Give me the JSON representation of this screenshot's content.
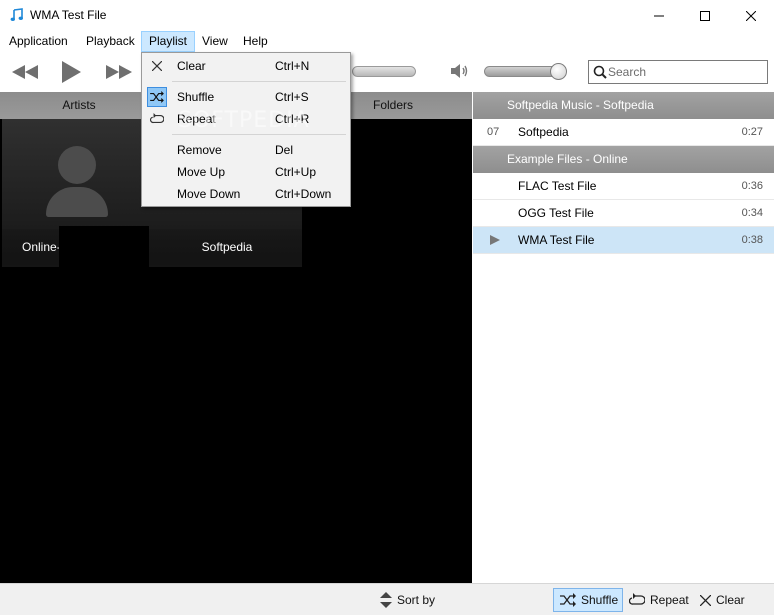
{
  "window": {
    "title": "WMA Test File"
  },
  "menu": [
    "Application",
    "Playback",
    "Playlist",
    "View",
    "Help"
  ],
  "search": {
    "placeholder": "Search",
    "value": ""
  },
  "volume": {
    "level": 0.88
  },
  "library": {
    "tabs": [
      "Artists",
      "",
      "Folders"
    ],
    "tiles": [
      "Online-",
      "Softpedia"
    ]
  },
  "dropdown": {
    "items": [
      {
        "label": "Clear",
        "shortcut": "Ctrl+N",
        "icon": "close-icon"
      },
      {
        "label": "Shuffle",
        "shortcut": "Ctrl+S",
        "icon": "shuffle-icon",
        "checked": true
      },
      {
        "label": "Repeat",
        "shortcut": "Ctrl+R",
        "icon": "repeat-icon"
      },
      {
        "label": "Remove",
        "shortcut": "Del"
      },
      {
        "label": "Move Up",
        "shortcut": "Ctrl+Up"
      },
      {
        "label": "Move Down",
        "shortcut": "Ctrl+Down"
      }
    ]
  },
  "playlist": {
    "groups": [
      {
        "title": "Softpedia Music - Softpedia",
        "tracks": [
          {
            "num": "07",
            "name": "Softpedia",
            "duration": "0:27"
          }
        ]
      },
      {
        "title": "Example Files - Online",
        "tracks": [
          {
            "num": "",
            "name": "FLAC Test File",
            "duration": "0:36"
          },
          {
            "num": "",
            "name": "OGG Test File",
            "duration": "0:34"
          },
          {
            "num": "",
            "name": "WMA Test File",
            "duration": "0:38",
            "playing": true
          }
        ]
      }
    ]
  },
  "statusbar": {
    "sort": "Sort by",
    "shuffle": "Shuffle",
    "repeat": "Repeat",
    "clear": "Clear"
  },
  "watermark": "SOFTPEDIA",
  "colors": {
    "selection": "#cde5f7",
    "menu_active": "#cce8ff",
    "group_header": "#999999"
  }
}
